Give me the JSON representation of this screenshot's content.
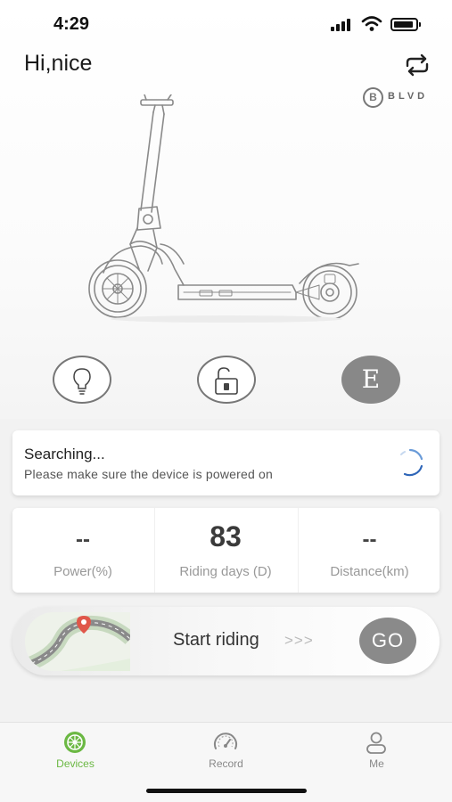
{
  "status_bar": {
    "time": "4:29",
    "icons": [
      "cellular-signal-icon",
      "wifi-icon",
      "battery-icon"
    ]
  },
  "header": {
    "greeting": "Hi,nice",
    "refresh_icon": "refresh-icon",
    "brand_mark": "B",
    "brand_name": "BLVD"
  },
  "device": {
    "image": "scooter-illustration",
    "controls": [
      {
        "name": "light",
        "icon": "lightbulb-icon"
      },
      {
        "name": "lock",
        "icon": "unlock-icon"
      },
      {
        "name": "mode",
        "label": "E"
      }
    ]
  },
  "connection": {
    "title": "Searching...",
    "subtitle": "Please make sure the device is powered on"
  },
  "stats": [
    {
      "value": "--",
      "label": "Power(%)"
    },
    {
      "value": "83",
      "label": "Riding days (D)"
    },
    {
      "value": "--",
      "label": "Distance(km)"
    }
  ],
  "ride": {
    "label": "Start riding",
    "arrows": ">>>",
    "go_label": "GO"
  },
  "tabbar": {
    "active": "Devices",
    "tabs": [
      {
        "label": "Devices",
        "icon": "scooter-wheel-icon"
      },
      {
        "label": "Record",
        "icon": "speedometer-icon"
      },
      {
        "label": "Me",
        "icon": "person-icon"
      }
    ]
  },
  "colors": {
    "accent": "#6bb843",
    "control_gray": "#888888",
    "background": "#f2f2f2"
  }
}
